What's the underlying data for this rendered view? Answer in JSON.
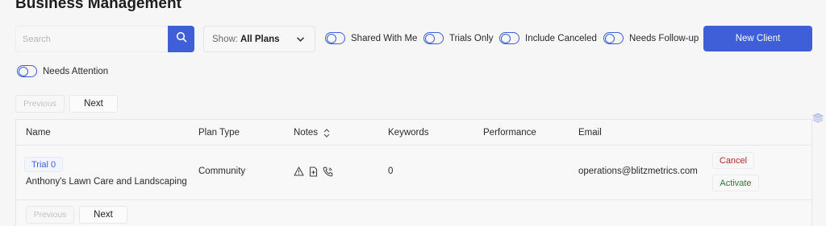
{
  "page": {
    "title": "Business Management"
  },
  "search": {
    "placeholder": "Search",
    "value": ""
  },
  "show_filter": {
    "prefix": "Show:",
    "value": "All Plans"
  },
  "toggles": [
    {
      "label": "Shared With Me"
    },
    {
      "label": "Trials Only"
    },
    {
      "label": "Include Canceled"
    },
    {
      "label": "Needs Follow-up"
    },
    {
      "label": "Needs Attention"
    }
  ],
  "new_client_label": "New Client",
  "pagination": {
    "previous": "Previous",
    "next": "Next"
  },
  "table": {
    "columns": [
      "Name",
      "Plan Type",
      "Notes",
      "Keywords",
      "Performance",
      "Email"
    ],
    "rows": [
      {
        "badge": "Trial 0",
        "name": "Anthony's Lawn Care and Landscaping",
        "plan_type": "Community",
        "note_icons": [
          "warning-icon",
          "add-file-icon",
          "phone-icon"
        ],
        "keywords": "0",
        "performance": "",
        "email": "operations@blitzmetrics.com",
        "actions": {
          "cancel": "Cancel",
          "activate": "Activate"
        }
      }
    ]
  },
  "colors": {
    "accent": "#3e5fd8",
    "cancel": "#b02a2a",
    "activate": "#2e7d32"
  }
}
